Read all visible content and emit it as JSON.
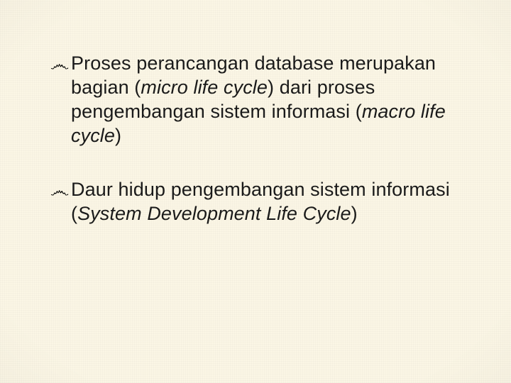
{
  "bullets": [
    {
      "glyph": "෴",
      "segments": [
        {
          "text": "Proses perancangan database merupakan bagian (",
          "italic": false
        },
        {
          "text": "micro life cycle",
          "italic": true
        },
        {
          "text": ") dari proses pengembangan sistem informasi (",
          "italic": false
        },
        {
          "text": "macro life cycle",
          "italic": true
        },
        {
          "text": ")",
          "italic": false
        }
      ]
    },
    {
      "glyph": "෴",
      "segments": [
        {
          "text": "Daur hidup pengembangan sistem informasi (",
          "italic": false
        },
        {
          "text": "System Development Life Cycle",
          "italic": true
        },
        {
          "text": ")",
          "italic": false
        }
      ]
    }
  ]
}
